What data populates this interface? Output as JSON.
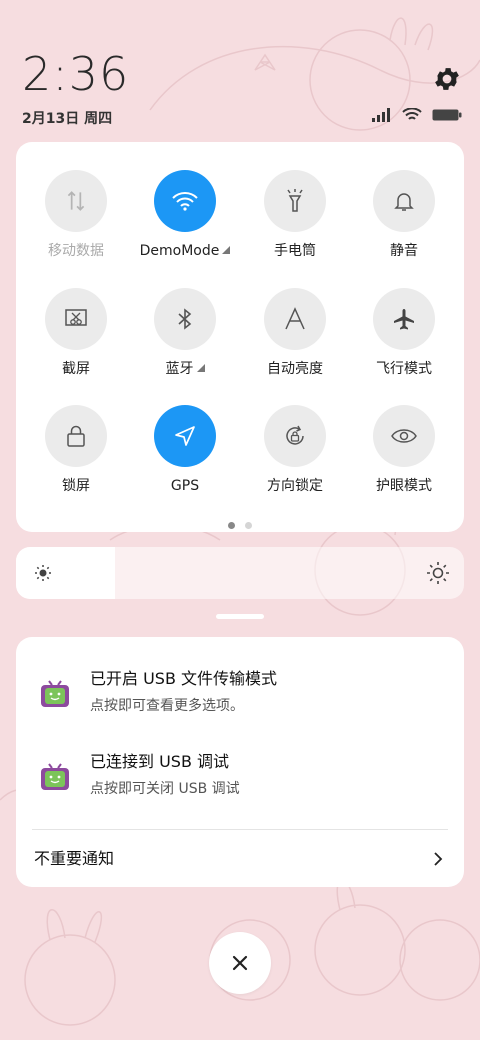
{
  "status": {
    "time": "2:36",
    "date": "2月13日 周四"
  },
  "quick_settings": {
    "tiles": [
      {
        "label": "移动数据",
        "icon": "mobile-data-icon",
        "active": false,
        "disabled": true
      },
      {
        "label": "DemoMode",
        "icon": "wifi-icon",
        "active": true,
        "expandable": true
      },
      {
        "label": "手电筒",
        "icon": "flashlight-icon",
        "active": false
      },
      {
        "label": "静音",
        "icon": "bell-icon",
        "active": false
      },
      {
        "label": "截屏",
        "icon": "screenshot-icon",
        "active": false
      },
      {
        "label": "蓝牙",
        "icon": "bluetooth-icon",
        "active": false,
        "expandable": true
      },
      {
        "label": "自动亮度",
        "icon": "auto-brightness-icon",
        "active": false
      },
      {
        "label": "飞行模式",
        "icon": "airplane-icon",
        "active": false
      },
      {
        "label": "锁屏",
        "icon": "lock-icon",
        "active": false
      },
      {
        "label": "GPS",
        "icon": "location-arrow-icon",
        "active": true
      },
      {
        "label": "方向锁定",
        "icon": "rotation-lock-icon",
        "active": false
      },
      {
        "label": "护眼模式",
        "icon": "eye-icon",
        "active": false
      }
    ],
    "page": 1,
    "pages": 2
  },
  "brightness": {
    "level": 0.22
  },
  "notifications": [
    {
      "title": "已开启 USB 文件传输模式",
      "body": "点按即可查看更多选项。",
      "icon": "android-tv-icon"
    },
    {
      "title": "已连接到 USB 调试",
      "body": "点按即可关闭 USB 调试",
      "icon": "android-tv-icon"
    }
  ],
  "unimportant_label": "不重要通知",
  "colors": {
    "accent": "#1c97f5",
    "background": "#f6dde0",
    "tile_inactive": "#ebebeb",
    "notif_icon_green": "#7cc45a",
    "notif_icon_purple": "#8d4a9e"
  }
}
